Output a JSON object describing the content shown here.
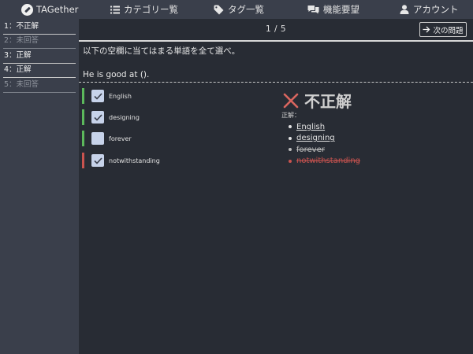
{
  "nav": {
    "brand": "TAGether",
    "category": "カテゴリー覧",
    "tag": "タグ一覧",
    "request": "機能要望",
    "account": "アカウント"
  },
  "sidebar": {
    "items": [
      {
        "label": "1：不正解",
        "status": "wrong"
      },
      {
        "label": "2：未回答",
        "status": "unanswered"
      },
      {
        "label": "3：正解",
        "status": "correct"
      },
      {
        "label": "4：正解",
        "status": "correct"
      },
      {
        "label": "5：未回答",
        "status": "unanswered"
      }
    ]
  },
  "header": {
    "page": "1 / 5",
    "next_label": "次の問題"
  },
  "question": {
    "instruction": "以下の空欄に当てはまる単語を全て選べ。",
    "sentence": "He is good at ()."
  },
  "choices": [
    {
      "label": "English",
      "checked": true,
      "mark": "correct"
    },
    {
      "label": "designing",
      "checked": true,
      "mark": "correct"
    },
    {
      "label": "forever",
      "checked": false,
      "mark": "correct"
    },
    {
      "label": "notwithstanding",
      "checked": true,
      "mark": "wrong"
    }
  ],
  "result": {
    "verdict": "不正解",
    "answer_label": "正解：",
    "answers": [
      {
        "text": "English",
        "kind": "correct"
      },
      {
        "text": "designing",
        "kind": "correct"
      },
      {
        "text": "forever",
        "kind": "struck"
      },
      {
        "text": "notwithstanding",
        "kind": "wrong"
      }
    ]
  },
  "colors": {
    "correct_bar": "#5cb85c",
    "wrong_bar": "#c9534f",
    "background": "#282c34",
    "nav_bg": "#3a3f4b"
  },
  "icons": {
    "brand": "pencil-logo-icon",
    "category": "list-icon",
    "tag": "tag-icon",
    "request": "chat-bubbles-icon",
    "account": "user-icon",
    "next": "arrow-right-icon",
    "verdict": "cross-icon"
  }
}
